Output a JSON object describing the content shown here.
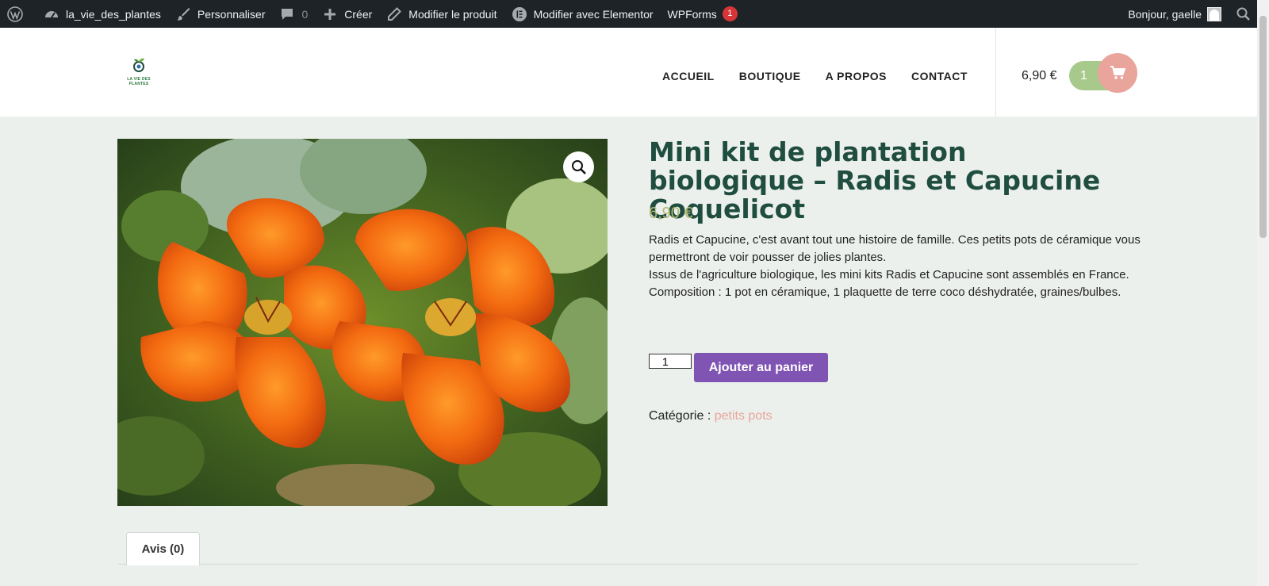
{
  "adminbar": {
    "wp_icon": "wordpress-icon",
    "site_name": "la_vie_des_plantes",
    "customize": "Personnaliser",
    "comments_count": "0",
    "new": "Créer",
    "edit_product": "Modifier le produit",
    "elementor": "Modifier avec Elementor",
    "wpforms": "WPForms",
    "wpforms_badge": "1",
    "greeting": "Bonjour, gaelle"
  },
  "header": {
    "logo_text": "LA VIE DES PLANTES",
    "nav": [
      "ACCUEIL",
      "BOUTIQUE",
      "A PROPOS",
      "CONTACT"
    ],
    "cart_total": "6,90 €",
    "cart_count": "1"
  },
  "product": {
    "title": "Mini kit de plantation biologique – Radis et Capucine Coquelicot",
    "price": "6,90 €",
    "description": [
      "Radis et Capucine, c'est avant tout une histoire de famille. Ces petits pots de céramique vous permettront de voir pousser de jolies plantes.",
      "Issus de l'agriculture biologique, les mini kits Radis et Capucine sont assemblés en France.",
      "Composition : 1 pot en céramique, 1 plaquette de terre coco déshydratée, graines/bulbes."
    ],
    "quantity": "1",
    "add_to_cart": "Ajouter au panier",
    "category_label": "Catégorie : ",
    "category": "petits pots"
  },
  "tabs": [
    "Avis (0)"
  ],
  "colors": {
    "title": "#1f4d3f",
    "price": "#b3b76f",
    "button": "#7f54b3",
    "accent": "#e9a49b",
    "cart_pill": "#a8c98c"
  }
}
